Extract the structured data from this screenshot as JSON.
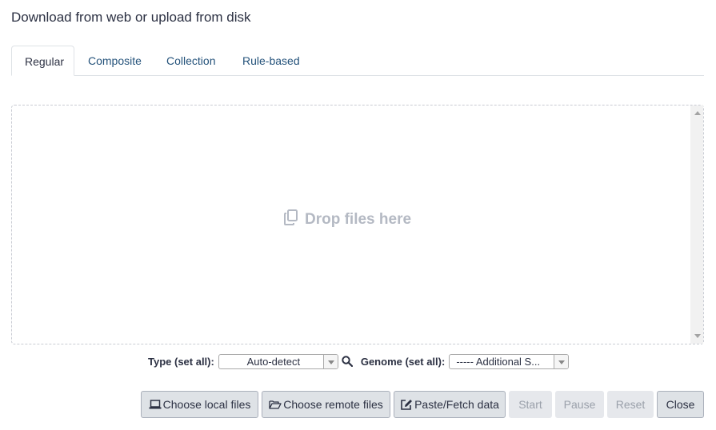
{
  "dialog": {
    "title": "Download from web or upload from disk"
  },
  "tabs": [
    {
      "label": "Regular",
      "active": true
    },
    {
      "label": "Composite",
      "active": false
    },
    {
      "label": "Collection",
      "active": false
    },
    {
      "label": "Rule-based",
      "active": false
    }
  ],
  "dropzone": {
    "hint": "Drop files here",
    "icon": "copy-icon"
  },
  "settings": {
    "type_label": "Type (set all):",
    "type_value": "Auto-detect",
    "search_icon": "search-icon",
    "genome_label": "Genome (set all):",
    "genome_value": "----- Additional S..."
  },
  "buttons": {
    "choose_local": "Choose local files",
    "choose_remote": "Choose remote files",
    "paste_fetch": "Paste/Fetch data",
    "start": "Start",
    "pause": "Pause",
    "reset": "Reset",
    "close": "Close"
  },
  "colors": {
    "link": "#25537b",
    "text": "#2c3143",
    "button_bg": "#dee2e6",
    "disabled_text": "#9aa0aa",
    "drop_hint": "#b4b9c3"
  }
}
